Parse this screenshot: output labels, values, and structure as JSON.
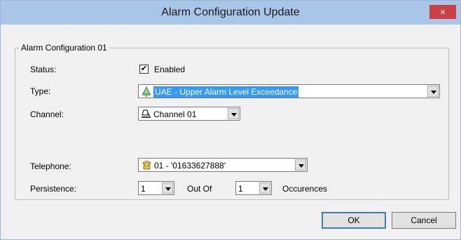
{
  "window": {
    "title": "Alarm Configuration Update",
    "close_symbol": "×"
  },
  "group": {
    "legend": "Alarm Configuration 01"
  },
  "fields": {
    "status_label": "Status:",
    "status_checked_mark": "✔",
    "status_value": "Enabled",
    "type_label": "Type:",
    "type_value": "UAE - Upper Alarm Level Exceedance",
    "type_icon": "alarm-bell-icon",
    "channel_label": "Channel:",
    "channel_value": "Channel 01",
    "channel_icon": "channel-bell-icon",
    "telephone_label": "Telephone:",
    "telephone_value": "01  -  '01633627888'",
    "telephone_icon": "telephone-icon",
    "persistence_label": "Persistence:",
    "persistence_value": "1",
    "out_of_label": "Out Of",
    "occurrences_value": "1",
    "occurrences_label": "Occurences"
  },
  "buttons": {
    "ok": "OK",
    "cancel": "Cancel"
  },
  "colors": {
    "titlebar": "#a8c7e8",
    "close": "#c94040",
    "selection": "#3399ff"
  }
}
